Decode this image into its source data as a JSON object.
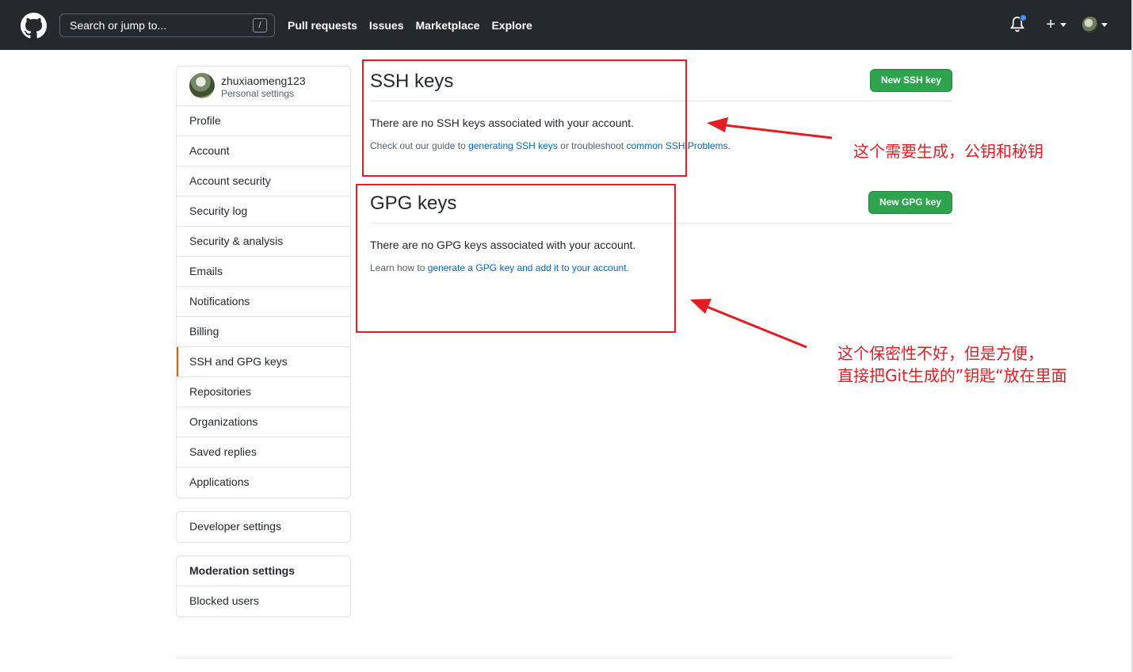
{
  "header": {
    "search_placeholder": "Search or jump to...",
    "search_shortcut": "/",
    "nav": [
      "Pull requests",
      "Issues",
      "Marketplace",
      "Explore"
    ],
    "plus": "+"
  },
  "sidebar": {
    "username": "zhuxiaomeng123",
    "subtitle": "Personal settings",
    "items": [
      {
        "label": "Profile"
      },
      {
        "label": "Account"
      },
      {
        "label": "Account security"
      },
      {
        "label": "Security log"
      },
      {
        "label": "Security & analysis"
      },
      {
        "label": "Emails"
      },
      {
        "label": "Notifications"
      },
      {
        "label": "Billing"
      },
      {
        "label": "SSH and GPG keys",
        "selected": true
      },
      {
        "label": "Repositories"
      },
      {
        "label": "Organizations"
      },
      {
        "label": "Saved replies"
      },
      {
        "label": "Applications"
      }
    ],
    "developer": "Developer settings",
    "moderation": {
      "title": "Moderation settings",
      "items": [
        "Blocked users"
      ]
    }
  },
  "ssh": {
    "title": "SSH keys",
    "button": "New SSH key",
    "blank": "There are no SSH keys associated with your account.",
    "note_pre": "Check out our guide to ",
    "link1": "generating SSH keys",
    "note_mid": " or troubleshoot ",
    "link2": "common SSH Problems",
    "note_post": "."
  },
  "gpg": {
    "title": "GPG keys",
    "button": "New GPG key",
    "blank": "There are no GPG keys associated with your account.",
    "note_pre": "Learn how to ",
    "link1": "generate a GPG key and add it to your account",
    "note_post": "."
  },
  "annotations": {
    "ssh_note": "这个需要生成，公钥和秘钥",
    "gpg_note_line1": "这个保密性不好，但是方便，",
    "gpg_note_line2": "直接把Git生成的”钥匙“放在里面"
  },
  "colors": {
    "header_bg": "#24292e",
    "accent_green": "#2ea44f",
    "link": "#0366d6",
    "annotation_red": "#e51c23",
    "selected_marker": "#e36209"
  }
}
